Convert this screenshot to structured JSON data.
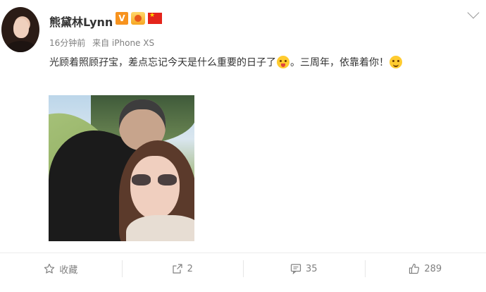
{
  "post": {
    "username": "熊黛林Lynn",
    "verified_badge": "V",
    "time": "16分钟前",
    "source": "来自 iPhone XS",
    "text_part1": "光顾着照顾孖宝，差点忘记今天是什么重要的日子了",
    "text_part2": "。三周年，依靠着你！",
    "emoji_1": "tongue-out-emoji",
    "emoji_2": "shy-emoji"
  },
  "actions": {
    "favorite_label": "收藏",
    "repost_count": "2",
    "comment_count": "35",
    "like_count": "289"
  },
  "colors": {
    "verified_orange": "#f7931e",
    "text_primary": "#333333",
    "text_secondary": "#808080"
  }
}
